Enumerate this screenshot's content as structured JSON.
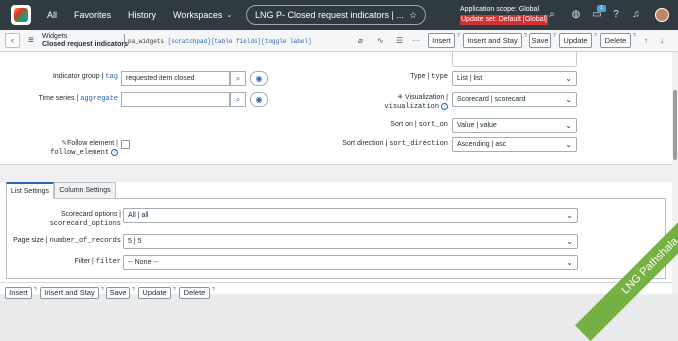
{
  "topnav": {
    "menus": [
      "All",
      "Favorites",
      "History",
      "Workspaces"
    ],
    "tab_title": "LNG P- Closed request indicators | ...",
    "scope_line": "Application scope: Global",
    "update_set": "Update set: Default [Global]",
    "badge_count": "1"
  },
  "header": {
    "table": "Widgets",
    "record": "Closed request indicators",
    "table_name": "pa_widgets",
    "links": "[scratchpad][table fields][toggle label]",
    "buttons": {
      "insert": "Insert",
      "insert_stay": "Insert and Stay",
      "save": "Save",
      "update": "Update",
      "delete": "Delete"
    }
  },
  "form": {
    "indicator_group": {
      "label": "Indicator group",
      "tech": "tag",
      "value": "requested item closed"
    },
    "time_series": {
      "label": "Time series",
      "tech": "aggregate",
      "value": ""
    },
    "type": {
      "label": "Type",
      "tech": "type",
      "value": "List | list"
    },
    "visualization": {
      "label": "Visualization",
      "tech": "visualization",
      "value": "Scorecard | scorecard"
    },
    "sort_on": {
      "label": "Sort on",
      "tech": "sort_on",
      "value": "Value | value"
    },
    "follow_element": {
      "label": "Follow element",
      "tech": "follow_element"
    },
    "sort_direction": {
      "label": "Sort direction",
      "tech": "sort_direction",
      "value": "Ascending | asc"
    }
  },
  "tabs": [
    "List Settings",
    "Column Settings"
  ],
  "list_settings": {
    "scorecard_options": {
      "label": "Scorecard options",
      "tech": "scorecard_options",
      "value": "All | all"
    },
    "page_size": {
      "label": "Page size",
      "tech": "number_of_records",
      "value": "5 | 5"
    },
    "filter": {
      "label": "Filter",
      "tech": "filter",
      "value": "-- None --"
    }
  },
  "footer": {
    "insert": "Insert",
    "insert_stay": "Insert and Stay",
    "save": "Save",
    "update": "Update",
    "delete": "Delete"
  },
  "watermark": "LNG Pathshala"
}
